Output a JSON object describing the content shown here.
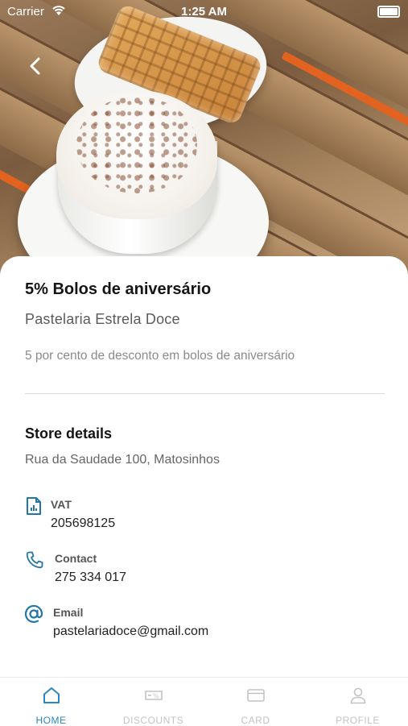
{
  "status_bar": {
    "carrier": "Carrier",
    "time": "1:25 AM"
  },
  "offer": {
    "title": "5% Bolos de aniversário",
    "store": "Pastelaria Estrela Doce",
    "description": "5 por cento de desconto em bolos de aniversário"
  },
  "store_details": {
    "heading": "Store details",
    "address": "Rua da Saudade 100, Matosinhos",
    "vat_label": "VAT",
    "vat_value": "205698125",
    "contact_label": "Contact",
    "contact_value": "275 334 017",
    "email_label": "Email",
    "email_value": "pastelariadoce@gmail.com"
  },
  "tabs": [
    {
      "label": "HOME",
      "icon": "home-icon",
      "active": true
    },
    {
      "label": "DISCOUNTS",
      "icon": "discount-ticket-icon",
      "active": false
    },
    {
      "label": "CARD",
      "icon": "card-icon",
      "active": false
    },
    {
      "label": "PROFILE",
      "icon": "profile-icon",
      "active": false
    }
  ],
  "colors": {
    "accent": "#2a86c2",
    "icon_accent": "#2377a8",
    "inactive": "#c3c3c3"
  }
}
